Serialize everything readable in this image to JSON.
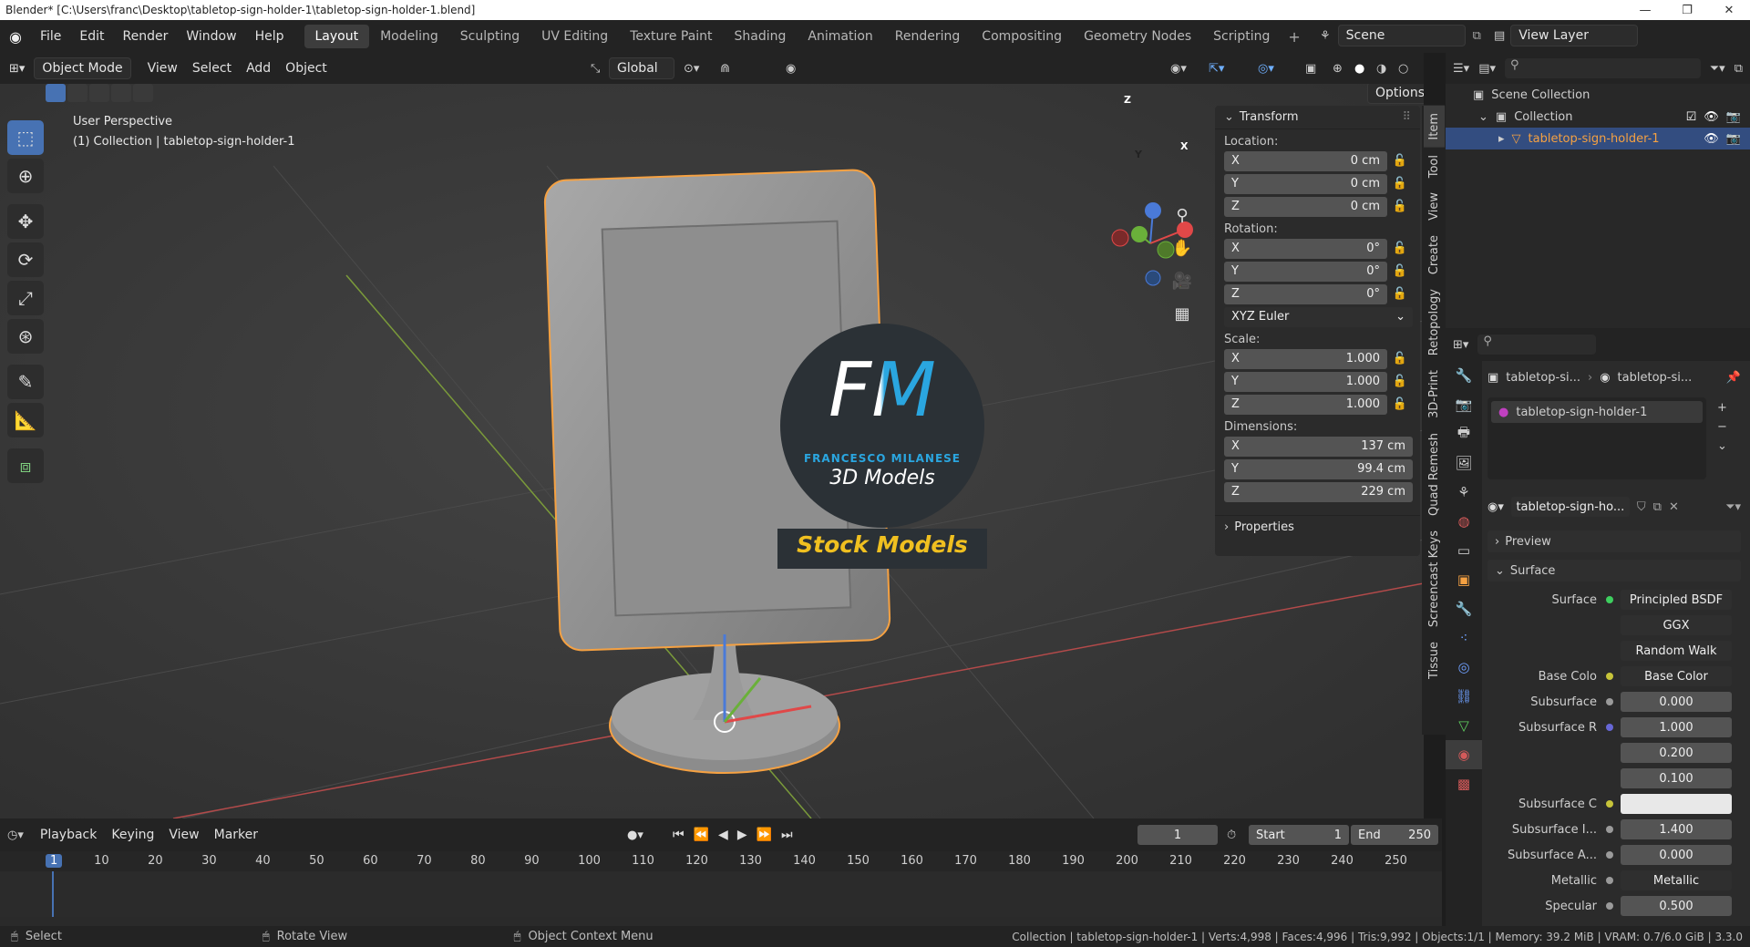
{
  "window": {
    "title": "Blender* [C:\\Users\\franc\\Desktop\\tabletop-sign-holder-1\\tabletop-sign-holder-1.blend]"
  },
  "menus": [
    "File",
    "Edit",
    "Render",
    "Window",
    "Help"
  ],
  "workspaces": [
    "Layout",
    "Modeling",
    "Sculpting",
    "UV Editing",
    "Texture Paint",
    "Shading",
    "Animation",
    "Rendering",
    "Compositing",
    "Geometry Nodes",
    "Scripting"
  ],
  "scene": "Scene",
  "view_layer": "View Layer",
  "viewport_header": {
    "mode": "Object Mode",
    "menus": [
      "View",
      "Select",
      "Add",
      "Object"
    ],
    "transform_orientation": "Global",
    "options": "Options"
  },
  "viewport": {
    "line1": "User Perspective",
    "line2": "(1) Collection | tabletop-sign-holder-1",
    "watermark_initials": "FM",
    "watermark_name": "FRANCESCO MILANESE",
    "watermark_sub": "3D Models",
    "watermark_banner": "Stock Models",
    "gizmo_axes": [
      "Z",
      "Y",
      "X"
    ]
  },
  "npanel": {
    "title": "Transform",
    "location_label": "Location:",
    "location": [
      [
        "X",
        "0 cm"
      ],
      [
        "Y",
        "0 cm"
      ],
      [
        "Z",
        "0 cm"
      ]
    ],
    "rotation_label": "Rotation:",
    "rotation": [
      [
        "X",
        "0°"
      ],
      [
        "Y",
        "0°"
      ],
      [
        "Z",
        "0°"
      ]
    ],
    "rotation_mode": "XYZ Euler",
    "scale_label": "Scale:",
    "scale": [
      [
        "X",
        "1.000"
      ],
      [
        "Y",
        "1.000"
      ],
      [
        "Z",
        "1.000"
      ]
    ],
    "dimensions_label": "Dimensions:",
    "dimensions": [
      [
        "X",
        "137 cm"
      ],
      [
        "Y",
        "99.4 cm"
      ],
      [
        "Z",
        "229 cm"
      ]
    ],
    "properties": "Properties"
  },
  "side_tabs": [
    "Item",
    "Tool",
    "View",
    "Create",
    "Retopology",
    "3D-Print",
    "Quad Remesh",
    "Screencast Keys",
    "Tissue"
  ],
  "outliner": {
    "scene_collection": "Scene Collection",
    "collection": "Collection",
    "object": "tabletop-sign-holder-1"
  },
  "properties": {
    "breadcrumb1": "tabletop-si...",
    "breadcrumb2": "tabletop-si...",
    "material_slot": "tabletop-sign-holder-1",
    "material_name": "tabletop-sign-ho...",
    "preview": "Preview",
    "surface_header": "Surface",
    "rows": [
      {
        "label": "Surface",
        "value": "Principled BSDF",
        "dot": "#3ecf5f"
      },
      {
        "label": "",
        "value": "GGX",
        "dot": ""
      },
      {
        "label": "",
        "value": "Random Walk",
        "dot": ""
      },
      {
        "label": "Base Colo",
        "value": "Base Color",
        "dot": "#c7c43a"
      },
      {
        "label": "Subsurface",
        "value": "0.000",
        "dot": "#9a9a9a"
      },
      {
        "label": "Subsurface R",
        "value": "1.000",
        "dot": "#6767d6"
      },
      {
        "label": "",
        "value": "0.200",
        "dot": ""
      },
      {
        "label": "",
        "value": "0.100",
        "dot": ""
      },
      {
        "label": "Subsurface C",
        "value": "",
        "dot": "#c7c43a"
      },
      {
        "label": "Subsurface I...",
        "value": "1.400",
        "dot": "#9a9a9a"
      },
      {
        "label": "Subsurface A...",
        "value": "0.000",
        "dot": "#9a9a9a"
      },
      {
        "label": "Metallic",
        "value": "Metallic",
        "dot": "#9a9a9a"
      },
      {
        "label": "Specular",
        "value": "0.500",
        "dot": "#9a9a9a"
      }
    ]
  },
  "timeline": {
    "menus": [
      "Playback",
      "Keying",
      "View",
      "Marker"
    ],
    "current_frame": "1",
    "start_label": "Start",
    "start": "1",
    "end_label": "End",
    "end": "250",
    "ticks": [
      "1",
      "10",
      "20",
      "30",
      "40",
      "50",
      "60",
      "70",
      "80",
      "90",
      "100",
      "110",
      "120",
      "130",
      "140",
      "150",
      "160",
      "170",
      "180",
      "190",
      "200",
      "210",
      "220",
      "230",
      "240",
      "250"
    ]
  },
  "status": {
    "select": "Select",
    "rotate": "Rotate View",
    "context": "Object Context Menu",
    "stats": "Collection | tabletop-sign-holder-1 | Verts:4,998 | Faces:4,996 | Tris:9,992 | Objects:1/1 | Memory: 39.2 MiB | VRAM: 0.7/6.0 GiB | 3.3.0"
  },
  "colors": {
    "accent": "#4772b3",
    "selection": "#f5a142",
    "fm_blue": "#2aa6e0",
    "banner_text": "#f0c020"
  }
}
